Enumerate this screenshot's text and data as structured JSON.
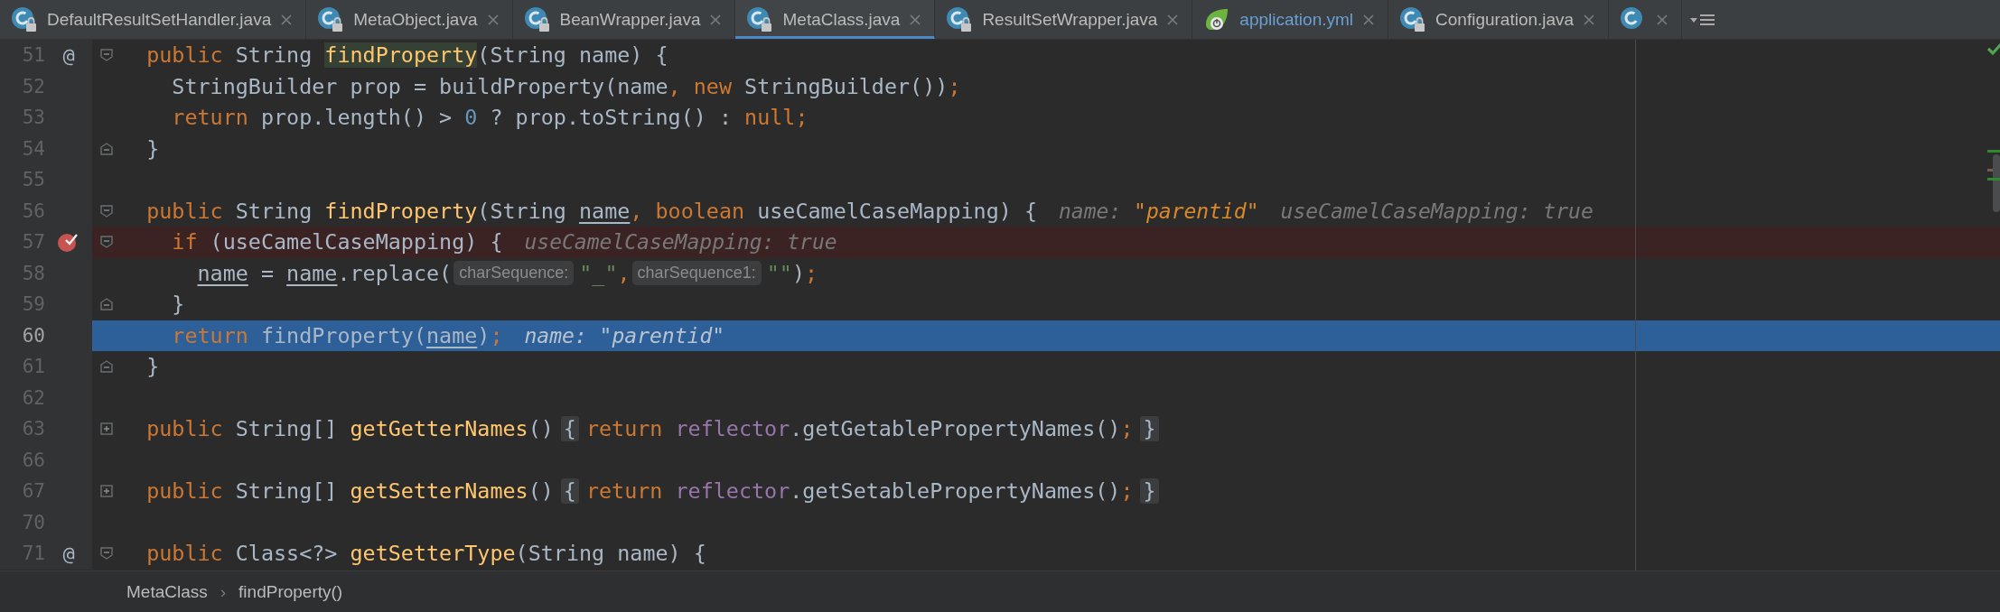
{
  "tabs": [
    {
      "label": "DefaultResultSetHandler.java",
      "kind": "class",
      "locked": true,
      "color": "#bbbbbb",
      "selected": false
    },
    {
      "label": "MetaObject.java",
      "kind": "class",
      "locked": true,
      "color": "#bbbbbb",
      "selected": false
    },
    {
      "label": "BeanWrapper.java",
      "kind": "class",
      "locked": true,
      "color": "#bbbbbb",
      "selected": false
    },
    {
      "label": "MetaClass.java",
      "kind": "class",
      "locked": true,
      "color": "#bbbbbb",
      "selected": true
    },
    {
      "label": "ResultSetWrapper.java",
      "kind": "class",
      "locked": true,
      "color": "#bbbbbb",
      "selected": false
    },
    {
      "label": "application.yml",
      "kind": "spring",
      "locked": false,
      "color": "#6a9fd4",
      "selected": false
    },
    {
      "label": "Configuration.java",
      "kind": "class",
      "locked": true,
      "color": "#bbbbbb",
      "selected": false
    },
    {
      "kind": "class",
      "locked": false,
      "selected": false
    }
  ],
  "editor": {
    "lines": [
      {
        "number": "51",
        "gutter_mark": "@",
        "fold_start": true,
        "fold_end": false,
        "collapsed": false,
        "breakpoint": false,
        "current": false,
        "segments": [
          {
            "kind": "code",
            "tokens": [
              {
                "kind": "kw",
                "t": "public"
              },
              {
                "kind": "plain",
                "t": " String "
              },
              {
                "kind": "fnm",
                "t": "findProperty"
              },
              {
                "kind": "plain",
                "t": "(String name) {"
              }
            ]
          }
        ]
      },
      {
        "number": "52",
        "fold_start": false,
        "fold_end": false,
        "collapsed": false,
        "breakpoint": false,
        "current": false,
        "segments": [
          {
            "kind": "code",
            "tokens": [
              {
                "kind": "plain",
                "t": "StringBuilder prop = buildProperty(name"
              },
              {
                "kind": "kw",
                "t": ", new"
              },
              {
                "kind": "plain",
                "t": " StringBuilder())"
              },
              {
                "kind": "kw",
                "t": ";"
              }
            ]
          }
        ]
      },
      {
        "number": "53",
        "fold_start": false,
        "fold_end": false,
        "collapsed": false,
        "breakpoint": false,
        "current": false,
        "segments": [
          {
            "kind": "code",
            "tokens": [
              {
                "kind": "kw",
                "t": "return"
              },
              {
                "kind": "plain",
                "t": " prop.length() > "
              },
              {
                "kind": "num",
                "t": "0"
              },
              {
                "kind": "plain",
                "t": " ? prop.toString() : "
              },
              {
                "kind": "kw",
                "t": "null;"
              }
            ]
          }
        ]
      },
      {
        "number": "54",
        "fold_start": false,
        "fold_end": true,
        "collapsed": false,
        "breakpoint": false,
        "current": false,
        "segments": [
          {
            "kind": "code",
            "tokens": [
              {
                "kind": "plain",
                "t": "}"
              }
            ]
          }
        ]
      },
      {
        "number": "55",
        "fold_start": false,
        "fold_end": false,
        "collapsed": false,
        "breakpoint": false,
        "current": false
      },
      {
        "number": "56",
        "fold_start": true,
        "fold_end": false,
        "collapsed": false,
        "breakpoint": false,
        "current": false,
        "segments": [
          {
            "kind": "code",
            "tokens": [
              {
                "kind": "kw",
                "t": "public"
              },
              {
                "kind": "plain",
                "t": " String "
              },
              {
                "kind": "fn",
                "t": "findProperty"
              },
              {
                "kind": "plain",
                "t": "(String "
              },
              {
                "kind": "u",
                "t": "name"
              },
              {
                "kind": "kw",
                "t": ", boolean"
              },
              {
                "kind": "plain",
                "t": " useCamelCaseMapping) {"
              }
            ]
          },
          {
            "kind": "value-hint",
            "tokens": [
              {
                "kind": "hl",
                "t": "name: "
              },
              {
                "kind": "hs",
                "t": "\"parentid\""
              }
            ]
          },
          {
            "kind": "value-hint",
            "tokens": [
              {
                "kind": "hl",
                "t": "useCamelCaseMapping: true"
              }
            ]
          }
        ]
      },
      {
        "number": "57",
        "fold_start": true,
        "fold_end": false,
        "collapsed": false,
        "breakpoint": true,
        "current": false,
        "segments": [
          {
            "kind": "code",
            "tokens": [
              {
                "kind": "kw",
                "t": "if"
              },
              {
                "kind": "plain",
                "t": " (useCamelCaseMapping) {"
              }
            ]
          },
          {
            "kind": "value-hint",
            "tokens": [
              {
                "kind": "hl",
                "t": "useCamelCaseMapping: true"
              }
            ]
          }
        ]
      },
      {
        "number": "58",
        "fold_start": false,
        "fold_end": false,
        "collapsed": false,
        "breakpoint": false,
        "current": false,
        "segments": [
          {
            "kind": "code",
            "tokens": [
              {
                "kind": "u",
                "t": "name"
              },
              {
                "kind": "plain",
                "t": " = "
              },
              {
                "kind": "u",
                "t": "name"
              },
              {
                "kind": "plain",
                "t": ".replace("
              }
            ]
          },
          {
            "kind": "param-hint",
            "text": "charSequence:"
          },
          {
            "kind": "code",
            "tokens": [
              {
                "kind": "str",
                "t": "\"_\""
              },
              {
                "kind": "kw",
                "t": ","
              }
            ]
          },
          {
            "kind": "param-hint",
            "text": "charSequence1:"
          },
          {
            "kind": "code",
            "tokens": [
              {
                "kind": "str",
                "t": "\"\""
              },
              {
                "kind": "plain",
                "t": ")"
              },
              {
                "kind": "kw",
                "t": ";"
              }
            ]
          }
        ]
      },
      {
        "number": "59",
        "fold_start": false,
        "fold_end": true,
        "collapsed": false,
        "breakpoint": false,
        "current": false,
        "segments": [
          {
            "kind": "code",
            "tokens": [
              {
                "kind": "plain",
                "t": "}"
              }
            ]
          }
        ]
      },
      {
        "number": "60",
        "fold_start": false,
        "fold_end": false,
        "collapsed": false,
        "breakpoint": false,
        "current": true,
        "segments": [
          {
            "kind": "code",
            "tokens": [
              {
                "kind": "kw",
                "t": "return"
              },
              {
                "kind": "plain",
                "t": " findProperty("
              },
              {
                "kind": "u",
                "t": "name"
              },
              {
                "kind": "plain",
                "t": ")"
              },
              {
                "kind": "kw",
                "t": ";"
              }
            ]
          },
          {
            "kind": "value-hint",
            "tokens": [
              {
                "kind": "hl",
                "t": "name: "
              },
              {
                "kind": "hs",
                "t": "\"parentid\""
              }
            ]
          }
        ]
      },
      {
        "number": "61",
        "fold_start": false,
        "fold_end": true,
        "collapsed": false,
        "breakpoint": false,
        "current": false,
        "segments": [
          {
            "kind": "code",
            "tokens": [
              {
                "kind": "plain",
                "t": "}"
              }
            ]
          }
        ]
      },
      {
        "number": "62",
        "fold_start": false,
        "fold_end": false,
        "collapsed": false,
        "breakpoint": false,
        "current": false
      },
      {
        "number": "63",
        "fold_start": false,
        "fold_end": false,
        "collapsed": true,
        "breakpoint": false,
        "current": false,
        "segments": [
          {
            "kind": "code",
            "tokens": [
              {
                "kind": "kw",
                "t": "public"
              },
              {
                "kind": "plain",
                "t": " String[] "
              },
              {
                "kind": "fn",
                "t": "getGetterNames"
              },
              {
                "kind": "plain",
                "t": "()"
              }
            ]
          },
          {
            "kind": "folded",
            "text": "{"
          },
          {
            "kind": "code",
            "tokens": [
              {
                "kind": "kw",
                "t": "return "
              },
              {
                "kind": "field",
                "t": "reflector"
              },
              {
                "kind": "plain",
                "t": ".getGetablePropertyNames()"
              },
              {
                "kind": "kw",
                "t": ";"
              }
            ]
          },
          {
            "kind": "folded",
            "text": "}"
          }
        ]
      },
      {
        "number": "66",
        "fold_start": false,
        "fold_end": false,
        "collapsed": false,
        "breakpoint": false,
        "current": false
      },
      {
        "number": "67",
        "fold_start": false,
        "fold_end": false,
        "collapsed": true,
        "breakpoint": false,
        "current": false,
        "segments": [
          {
            "kind": "code",
            "tokens": [
              {
                "kind": "kw",
                "t": "public"
              },
              {
                "kind": "plain",
                "t": " String[] "
              },
              {
                "kind": "fn",
                "t": "getSetterNames"
              },
              {
                "kind": "plain",
                "t": "()"
              }
            ]
          },
          {
            "kind": "folded",
            "text": "{"
          },
          {
            "kind": "code",
            "tokens": [
              {
                "kind": "kw",
                "t": "return "
              },
              {
                "kind": "field",
                "t": "reflector"
              },
              {
                "kind": "plain",
                "t": ".getSetablePropertyNames()"
              },
              {
                "kind": "kw",
                "t": ";"
              }
            ]
          },
          {
            "kind": "folded",
            "text": "}"
          }
        ]
      },
      {
        "number": "70",
        "fold_start": false,
        "fold_end": false,
        "collapsed": false,
        "breakpoint": false,
        "current": false
      },
      {
        "number": "71",
        "gutter_mark": "@",
        "fold_start": true,
        "fold_end": false,
        "collapsed": false,
        "breakpoint": false,
        "current": false,
        "segments": [
          {
            "kind": "code",
            "tokens": [
              {
                "kind": "kw",
                "t": "public"
              },
              {
                "kind": "plain",
                "t": " Class<?> "
              },
              {
                "kind": "fn",
                "t": "getSetterType"
              },
              {
                "kind": "plain",
                "t": "(String name) {"
              }
            ]
          }
        ]
      }
    ]
  },
  "breadcrumb": [
    "MetaClass",
    "findProperty()"
  ],
  "breadcrumb_separator": "›"
}
